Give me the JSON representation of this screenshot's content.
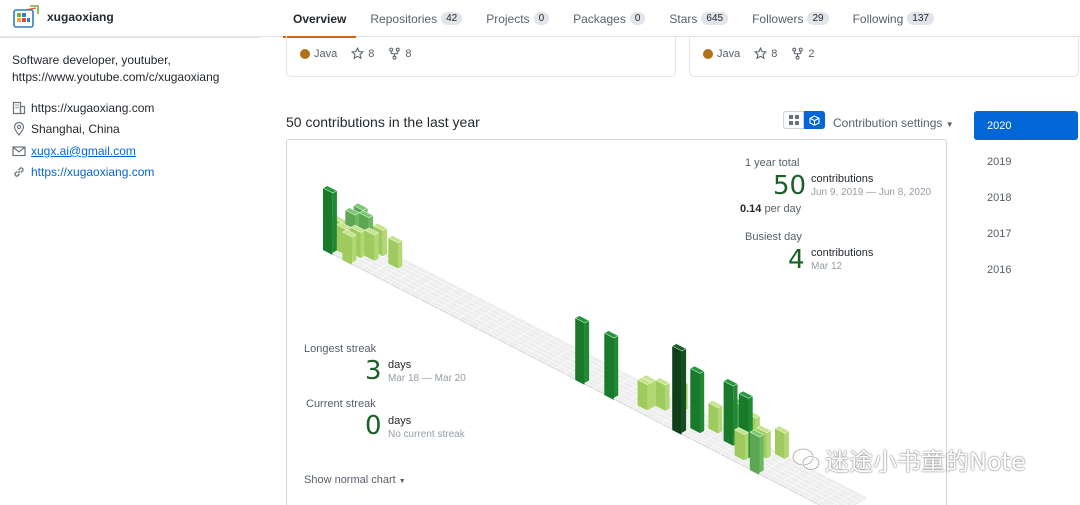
{
  "profile": {
    "username": "xugaoxiang",
    "bio_line1": "Software developer, youtuber,",
    "bio_line2": "https://www.youtube.com/c/xugaoxiang",
    "company": "https://xugaoxiang.com",
    "location": "Shanghai, China",
    "email": "xugx.ai@gmail.com",
    "website": "https://xugaoxiang.com"
  },
  "tabs": [
    {
      "label": "Overview",
      "count": null
    },
    {
      "label": "Repositories",
      "count": "42"
    },
    {
      "label": "Projects",
      "count": "0"
    },
    {
      "label": "Packages",
      "count": "0"
    },
    {
      "label": "Stars",
      "count": "645"
    },
    {
      "label": "Followers",
      "count": "29"
    },
    {
      "label": "Following",
      "count": "137"
    }
  ],
  "repo_cards": [
    {
      "language": "Java",
      "stars": "8",
      "forks": "8"
    },
    {
      "language": "Java",
      "stars": "8",
      "forks": "2"
    }
  ],
  "contributions": {
    "heading": "50 contributions in the last year",
    "settings_label": "Contribution settings",
    "show_normal_label": "Show normal chart",
    "year_total_label": "1 year total",
    "year_total_value": "50",
    "year_total_unit": "contributions",
    "year_total_range": "Jun 9, 2019 — Jun 8, 2020",
    "per_day_value": "0.14",
    "per_day_text": "per day",
    "busiest_label": "Busiest day",
    "busiest_value": "4",
    "busiest_unit": "contributions",
    "busiest_date": "Mar 12",
    "longest_label": "Longest streak",
    "longest_value": "3",
    "longest_unit": "days",
    "longest_range": "Mar 18 — Mar 20",
    "current_label": "Current streak",
    "current_value": "0",
    "current_unit": "days",
    "current_sub": "No current streak"
  },
  "years": [
    "2020",
    "2019",
    "2018",
    "2017",
    "2016"
  ],
  "watermark": "迷途小书童的Note",
  "colors": {
    "accent": "#0366d6",
    "tab_underline": "#e36209",
    "level1": "#c6e48b",
    "level2": "#7bc96f",
    "level3": "#239a3b",
    "level4": "#196127"
  },
  "chart_data": {
    "type": "heatmap",
    "description": "isometric contribution graph (week × weekday)",
    "cells": [
      {
        "week": 0,
        "day": 0,
        "level": 3
      },
      {
        "week": 0,
        "day": 2,
        "level": 1
      },
      {
        "week": 1,
        "day": 1,
        "level": 1
      },
      {
        "week": 1,
        "day": 3,
        "level": 2
      },
      {
        "week": 1,
        "day": 5,
        "level": 2
      },
      {
        "week": 2,
        "day": 0,
        "level": 1
      },
      {
        "week": 2,
        "day": 2,
        "level": 1
      },
      {
        "week": 2,
        "day": 4,
        "level": 2
      },
      {
        "week": 3,
        "day": 3,
        "level": 1
      },
      {
        "week": 3,
        "day": 5,
        "level": 1
      },
      {
        "week": 5,
        "day": 4,
        "level": 1
      },
      {
        "week": 26,
        "day": 0,
        "level": 3
      },
      {
        "week": 29,
        "day": 0,
        "level": 3
      },
      {
        "week": 32,
        "day": 1,
        "level": 1
      },
      {
        "week": 32,
        "day": 2,
        "level": 1
      },
      {
        "week": 33,
        "day": 3,
        "level": 1
      },
      {
        "week": 34,
        "day": 5,
        "level": 1
      },
      {
        "week": 36,
        "day": 0,
        "level": 4
      },
      {
        "week": 37,
        "day": 2,
        "level": 3
      },
      {
        "week": 38,
        "day": 4,
        "level": 1
      },
      {
        "week": 39,
        "day": 6,
        "level": 1
      },
      {
        "week": 40,
        "day": 5,
        "level": 2
      },
      {
        "week": 40,
        "day": 3,
        "level": 3
      },
      {
        "week": 41,
        "day": 6,
        "level": 1
      },
      {
        "week": 42,
        "day": 1,
        "level": 1
      },
      {
        "week": 42,
        "day": 2,
        "level": 3
      },
      {
        "week": 43,
        "day": 4,
        "level": 1
      },
      {
        "week": 44,
        "day": 0,
        "level": 2
      },
      {
        "week": 44,
        "day": 6,
        "level": 1
      }
    ]
  }
}
